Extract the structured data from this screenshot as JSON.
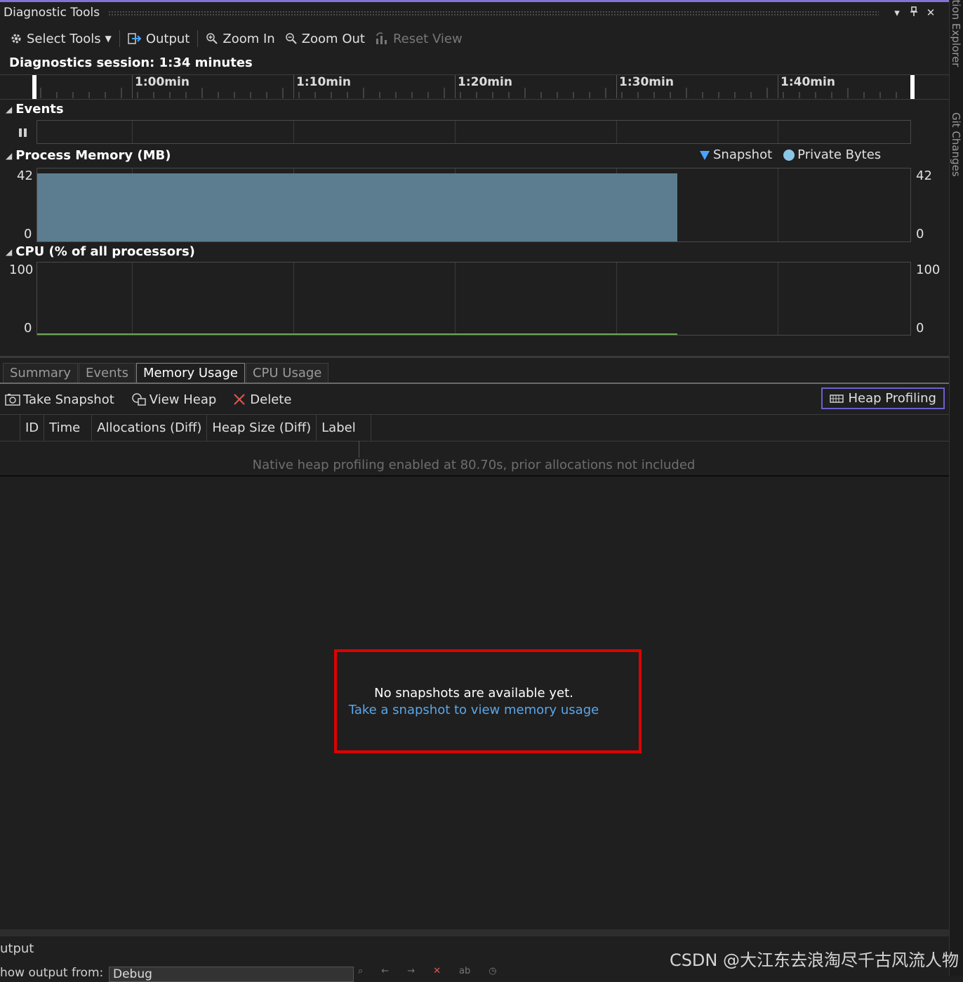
{
  "window": {
    "title": "Diagnostic Tools",
    "controls": [
      "▾",
      "🖈",
      "✕"
    ]
  },
  "toolbar": {
    "select_tools": "Select Tools",
    "output": "Output",
    "zoom_in": "Zoom In",
    "zoom_out": "Zoom Out",
    "reset_view": "Reset View"
  },
  "session": {
    "label": "Diagnostics session: 1:34 minutes"
  },
  "timeline": {
    "ticks": [
      "1:00min",
      "1:10min",
      "1:20min",
      "1:30min",
      "1:40min"
    ]
  },
  "events": {
    "title": "Events"
  },
  "memory": {
    "title": "Process Memory (MB)",
    "legend_snapshot": "Snapshot",
    "legend_private": "Private Bytes",
    "max": "42",
    "min": "0",
    "max_value": 42,
    "fill_fraction_time": 0.733,
    "level_fraction": 0.93,
    "colors": {
      "fill": "#5b7d8f",
      "snapshot": "#4aa3ff",
      "private": "#8cc6e6"
    }
  },
  "cpu": {
    "title": "CPU (% of all processors)",
    "max": "100",
    "min": "0",
    "line_color": "#6aa84f"
  },
  "tabs": [
    "Summary",
    "Events",
    "Memory Usage",
    "CPU Usage"
  ],
  "active_tab": "Memory Usage",
  "mem_toolbar": {
    "take_snapshot": "Take Snapshot",
    "view_heap": "View Heap",
    "delete": "Delete",
    "heap_profiling": "Heap Profiling"
  },
  "table": {
    "columns": [
      "ID",
      "Time",
      "Allocations (Diff)",
      "Heap Size (Diff)",
      "Label"
    ]
  },
  "note": "Native heap profiling enabled at 80.70s, prior allocations not included",
  "empty_state": {
    "message": "No snapshots are available yet.",
    "link": "Take a snapshot to view memory usage"
  },
  "output_panel": {
    "title": "utput",
    "show_from": "how output from:",
    "source": "Debug"
  },
  "side_panel": {
    "label1": "ution Explorer",
    "label2": "Git Changes"
  },
  "watermark": "CSDN @大江东去浪淘尽千古风流人物"
}
